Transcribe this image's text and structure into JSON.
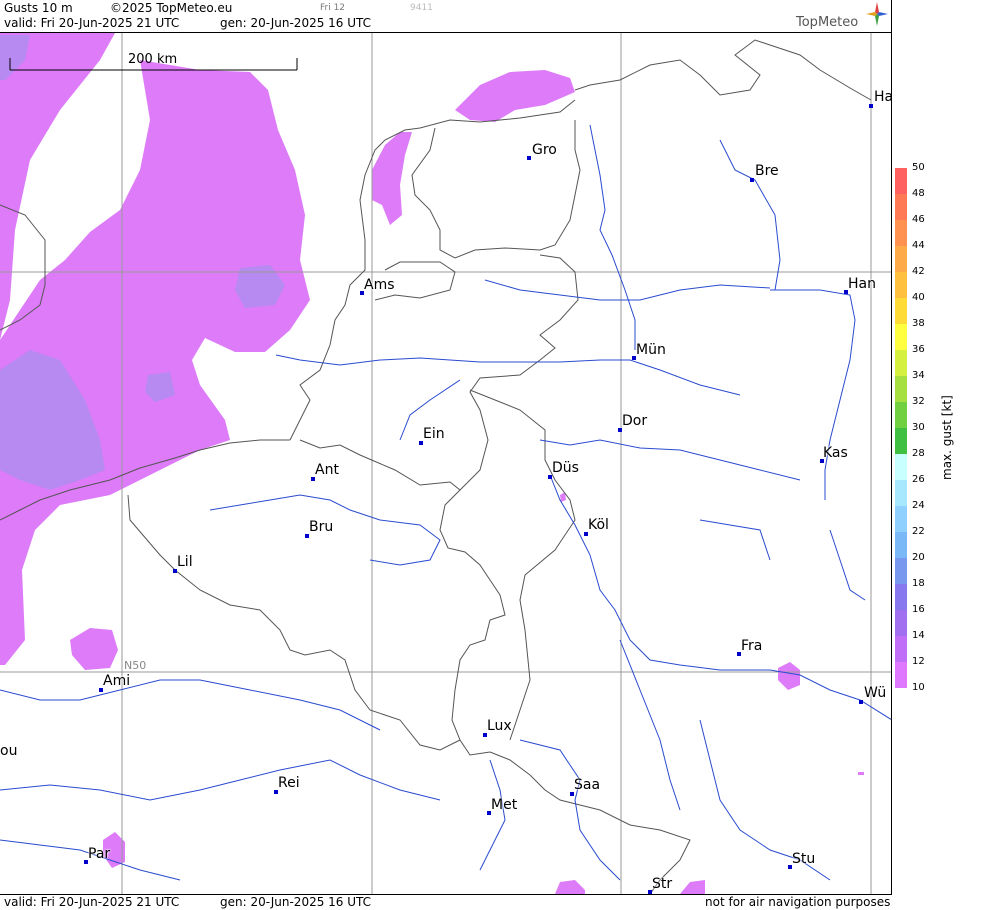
{
  "header": {
    "title": "Gusts 10 m",
    "copyright": "©2025 TopMeteo.eu",
    "day_label": "Fri 12",
    "code": "9411",
    "valid": "valid:  Fri  20-Jun-2025  21 UTC",
    "gen": "gen: 20-Jun-2025 16 UTC",
    "logo": "TopMeteo"
  },
  "footer": {
    "valid": "valid:  Fri  20-Jun-2025  21 UTC",
    "gen": "gen: 20-Jun-2025 16 UTC",
    "disclaimer": "not for air navigation purposes"
  },
  "scale": {
    "label": "200 km"
  },
  "grid": {
    "lat_label": "N50"
  },
  "cities": [
    {
      "name": "Ha"
    },
    {
      "name": "Gro"
    },
    {
      "name": "Bre"
    },
    {
      "name": "Ams"
    },
    {
      "name": "Han"
    },
    {
      "name": "Mün"
    },
    {
      "name": "Dor"
    },
    {
      "name": "Ein"
    },
    {
      "name": "Kas"
    },
    {
      "name": "Düs"
    },
    {
      "name": "Ant"
    },
    {
      "name": "Köl"
    },
    {
      "name": "Bru"
    },
    {
      "name": "Lil"
    },
    {
      "name": "Fra"
    },
    {
      "name": "Ami"
    },
    {
      "name": "Wü"
    },
    {
      "name": "ou"
    },
    {
      "name": "Lux"
    },
    {
      "name": "Rei"
    },
    {
      "name": "Saa"
    },
    {
      "name": "Met"
    },
    {
      "name": "Par"
    },
    {
      "name": "Stu"
    },
    {
      "name": "Str"
    }
  ],
  "legend": {
    "unit": "max. gust [kt]",
    "ticks": [
      "50",
      "48",
      "46",
      "44",
      "42",
      "40",
      "38",
      "36",
      "34",
      "32",
      "30",
      "28",
      "26",
      "24",
      "22",
      "20",
      "18",
      "16",
      "14",
      "12",
      "10"
    ],
    "colors": [
      "#ff6060",
      "#ff7a55",
      "#ff9250",
      "#ffaa48",
      "#ffc040",
      "#ffdb38",
      "#ffff40",
      "#d6f040",
      "#a6e040",
      "#70d040",
      "#40c040",
      "#c8ffff",
      "#a8e8ff",
      "#90d0ff",
      "#7ab8f8",
      "#7898f0",
      "#8878f0",
      "#a070f0",
      "#c070f8",
      "#e078ff"
    ],
    "accent_fill": "#dd7bf8",
    "accent_fill_dark": "#b68af0"
  }
}
